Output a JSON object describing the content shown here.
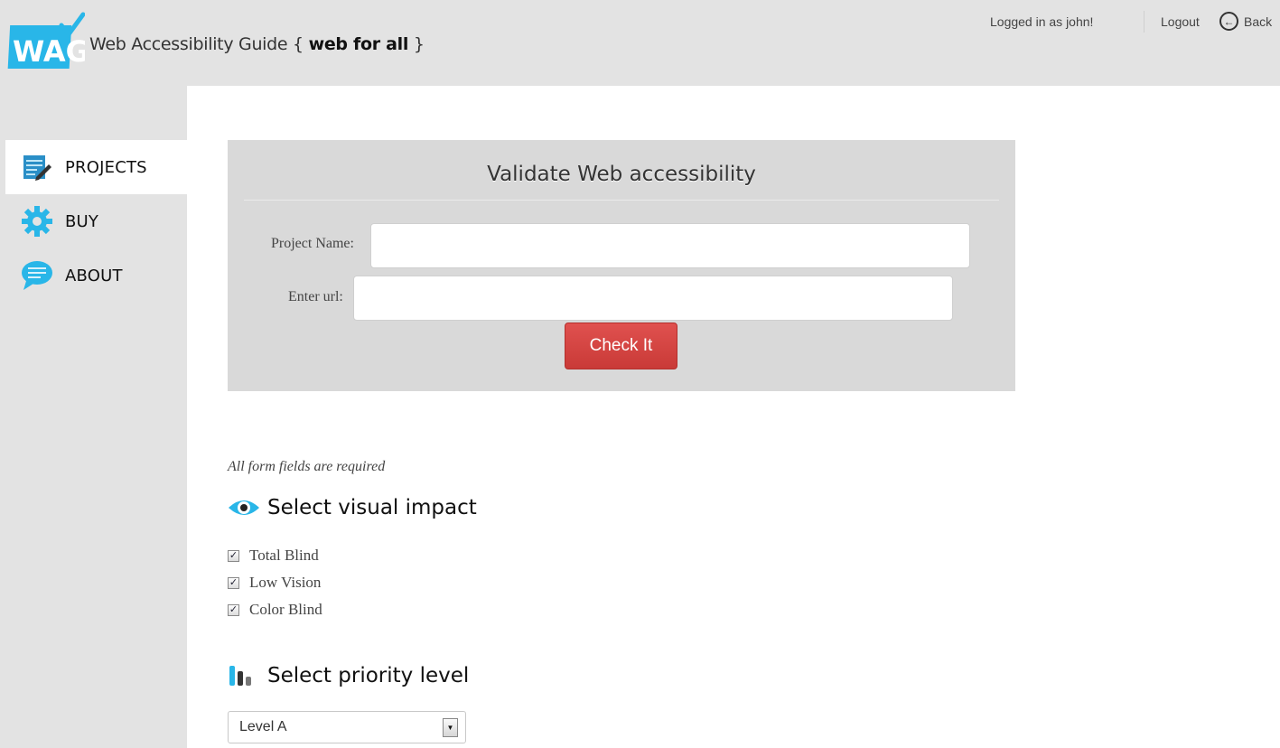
{
  "header": {
    "logo_text": "WAG",
    "brand_prefix": "Web Accessibility Guide { ",
    "brand_bold": "web for all",
    "brand_suffix": " }",
    "logged_in": "Logged in as john!",
    "logout": "Logout",
    "back": "Back"
  },
  "sidebar": {
    "items": [
      {
        "label": "PROJECTS",
        "icon": "edit-document-icon",
        "active": true
      },
      {
        "label": "BUY",
        "icon": "gear-icon",
        "active": false
      },
      {
        "label": "ABOUT",
        "icon": "chat-bubble-icon",
        "active": false
      }
    ]
  },
  "form": {
    "title": "Validate Web accessibility",
    "project_name_label": "Project Name:",
    "project_name_value": "",
    "url_label": "Enter url:",
    "url_value": "",
    "submit": "Check It"
  },
  "required_note": "All form fields are required",
  "visual_impact": {
    "title": "Select visual impact",
    "icon": "eye-icon",
    "options": [
      {
        "label": "Total Blind",
        "checked": true
      },
      {
        "label": "Low Vision",
        "checked": true
      },
      {
        "label": "Color Blind",
        "checked": true
      }
    ]
  },
  "priority": {
    "title": "Select priority level",
    "icon": "bar-chart-icon",
    "selected": "Level A"
  },
  "colors": {
    "accent_blue": "#29b6e8",
    "button_red": "#d9443f",
    "panel_gray": "#d9d9d9",
    "page_gray": "#e3e3e3"
  }
}
